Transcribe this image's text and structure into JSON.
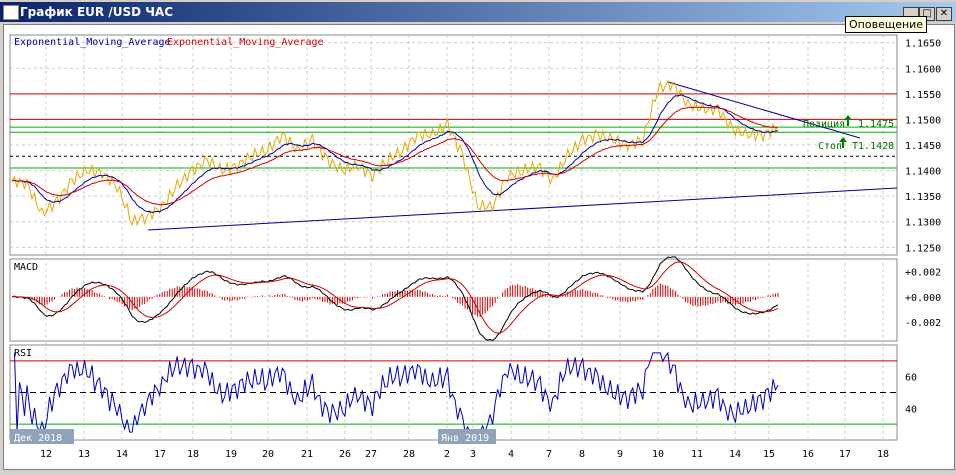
{
  "window": {
    "title": "График EUR /USD  ЧАС",
    "tooltip": "Оповещение",
    "min": "_",
    "max": "□",
    "close": "✕"
  },
  "legend": {
    "ema1": "Exponential_Moving_Average",
    "ema2": "Exponential_Moving_Average"
  },
  "price_axis": [
    "1.1650",
    "1.1600",
    "1.1550",
    "1.1500",
    "1.1450",
    "1.1400",
    "1.1350",
    "1.1300",
    "1.1250"
  ],
  "macd": {
    "label": "MACD",
    "ticks": [
      "+0.002",
      "+0.000",
      "-0.002"
    ]
  },
  "rsi": {
    "label": "RSI",
    "ticks": [
      "60",
      "40"
    ]
  },
  "orders": {
    "position": "Позиция",
    "position_price": "1.1475",
    "stop": "Стоп",
    "stop_price": "T1.1428"
  },
  "date_tags": [
    "Дек 2018",
    "Янв 2019"
  ],
  "colors": {
    "price": "#e8a800",
    "ema_fast": "#0000a0",
    "ema_slow": "#d00000",
    "green": "#00b000"
  },
  "chart_data": {
    "type": "line",
    "title": "EUR/USD H1",
    "ylim": [
      1.1235,
      1.1665
    ],
    "x_ticks": [
      "12",
      "13",
      "14",
      "17",
      "18",
      "19",
      "20",
      "21",
      "26",
      "27",
      "28",
      "2",
      "3",
      "4",
      "7",
      "8",
      "9",
      "10",
      "11",
      "14",
      "15",
      "16",
      "17",
      "18"
    ],
    "price": [
      1.138,
      1.1375,
      1.1315,
      1.134,
      1.138,
      1.14,
      1.1395,
      1.137,
      1.13,
      1.131,
      1.133,
      1.137,
      1.14,
      1.142,
      1.14,
      1.141,
      1.143,
      1.144,
      1.147,
      1.144,
      1.146,
      1.142,
      1.14,
      1.141,
      1.139,
      1.142,
      1.144,
      1.147,
      1.147,
      1.149,
      1.143,
      1.133,
      1.133,
      1.139,
      1.14,
      1.141,
      1.138,
      1.143,
      1.146,
      1.147,
      1.146,
      1.145,
      1.146,
      1.156,
      1.157,
      1.153,
      1.152,
      1.152,
      1.148,
      1.147,
      1.147,
      1.1485
    ],
    "hlines": [
      {
        "y": 1.155,
        "color": "red"
      },
      {
        "y": 1.15,
        "color": "red"
      },
      {
        "y": 1.1485,
        "color": "green"
      },
      {
        "y": 1.1475,
        "color": "green"
      },
      {
        "y": 1.1428,
        "color": "black-dashed"
      },
      {
        "y": 1.1405,
        "color": "green"
      }
    ],
    "macd_range": [
      -0.0035,
      0.003
    ],
    "rsi_range": [
      20,
      80
    ],
    "rsi_levels": [
      70,
      50,
      30
    ]
  }
}
